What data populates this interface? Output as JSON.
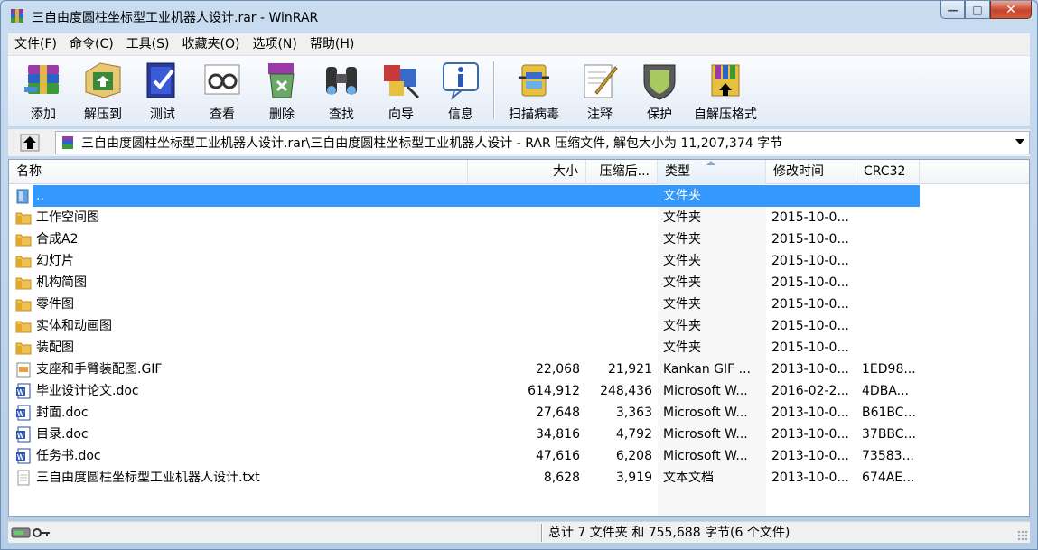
{
  "window": {
    "title": "三自由度圆柱坐标型工业机器人设计.rar - WinRAR",
    "minimize_glyph": "—",
    "maximize_glyph": "□",
    "close_glyph": "✕"
  },
  "menu": [
    "文件(F)",
    "命令(C)",
    "工具(S)",
    "收藏夹(O)",
    "选项(N)",
    "帮助(H)"
  ],
  "toolbar": [
    {
      "label": "添加",
      "icon": "add-archive-icon"
    },
    {
      "label": "解压到",
      "icon": "extract-to-icon"
    },
    {
      "label": "测试",
      "icon": "test-icon"
    },
    {
      "label": "查看",
      "icon": "view-icon"
    },
    {
      "label": "删除",
      "icon": "delete-icon"
    },
    {
      "label": "查找",
      "icon": "find-binoculars-icon"
    },
    {
      "label": "向导",
      "icon": "wizard-icon"
    },
    {
      "label": "信息",
      "icon": "info-icon"
    },
    {
      "label": "扫描病毒",
      "icon": "virus-scan-icon"
    },
    {
      "label": "注释",
      "icon": "comment-icon"
    },
    {
      "label": "保护",
      "icon": "protect-shield-icon"
    },
    {
      "label": "自解压格式",
      "icon": "sfx-icon"
    }
  ],
  "address": {
    "path": "三自由度圆柱坐标型工业机器人设计.rar\\三自由度圆柱坐标型工业机器人设计 - RAR 压缩文件, 解包大小为 11,207,374 字节"
  },
  "columns": {
    "name": "名称",
    "size": "大小",
    "packed": "压缩后...",
    "type": "类型",
    "modified": "修改时间",
    "crc": "CRC32"
  },
  "files": [
    {
      "name": "..",
      "size": "",
      "packed": "",
      "type": "文件夹",
      "modified": "",
      "crc": "",
      "icon": "parent-folder-icon",
      "selected": true
    },
    {
      "name": "工作空间图",
      "size": "",
      "packed": "",
      "type": "文件夹",
      "modified": "2015-10-0...",
      "crc": "",
      "icon": "folder-icon"
    },
    {
      "name": "合成A2",
      "size": "",
      "packed": "",
      "type": "文件夹",
      "modified": "2015-10-0...",
      "crc": "",
      "icon": "folder-icon"
    },
    {
      "name": "幻灯片",
      "size": "",
      "packed": "",
      "type": "文件夹",
      "modified": "2015-10-0...",
      "crc": "",
      "icon": "folder-icon"
    },
    {
      "name": "机构简图",
      "size": "",
      "packed": "",
      "type": "文件夹",
      "modified": "2015-10-0...",
      "crc": "",
      "icon": "folder-icon"
    },
    {
      "name": "零件图",
      "size": "",
      "packed": "",
      "type": "文件夹",
      "modified": "2015-10-0...",
      "crc": "",
      "icon": "folder-icon"
    },
    {
      "name": "实体和动画图",
      "size": "",
      "packed": "",
      "type": "文件夹",
      "modified": "2015-10-0...",
      "crc": "",
      "icon": "folder-icon"
    },
    {
      "name": "装配图",
      "size": "",
      "packed": "",
      "type": "文件夹",
      "modified": "2015-10-0...",
      "crc": "",
      "icon": "folder-icon"
    },
    {
      "name": "支座和手臂装配图.GIF",
      "size": "22,068",
      "packed": "21,921",
      "type": "Kankan GIF ...",
      "modified": "2013-10-0...",
      "crc": "1ED98...",
      "icon": "gif-file-icon"
    },
    {
      "name": "毕业设计论文.doc",
      "size": "614,912",
      "packed": "248,436",
      "type": "Microsoft W...",
      "modified": "2016-02-2...",
      "crc": "4DBA...",
      "icon": "word-doc-icon"
    },
    {
      "name": "封面.doc",
      "size": "27,648",
      "packed": "3,363",
      "type": "Microsoft W...",
      "modified": "2013-10-0...",
      "crc": "B61BC...",
      "icon": "word-doc-icon"
    },
    {
      "name": "目录.doc",
      "size": "34,816",
      "packed": "4,792",
      "type": "Microsoft W...",
      "modified": "2013-10-0...",
      "crc": "37BBC...",
      "icon": "word-doc-icon"
    },
    {
      "name": "任务书.doc",
      "size": "47,616",
      "packed": "6,208",
      "type": "Microsoft W...",
      "modified": "2013-10-0...",
      "crc": "73583...",
      "icon": "word-doc-icon"
    },
    {
      "name": "三自由度圆柱坐标型工业机器人设计.txt",
      "size": "8,628",
      "packed": "3,919",
      "type": "文本文档",
      "modified": "2013-10-0...",
      "crc": "674AE...",
      "icon": "text-file-icon"
    }
  ],
  "status": {
    "summary": "总计 7 文件夹 和 755,688 字节(6 个文件)"
  },
  "colors": {
    "selection": "#3399ff",
    "folder": "#f0c050",
    "frame": "#bcd3ea"
  }
}
